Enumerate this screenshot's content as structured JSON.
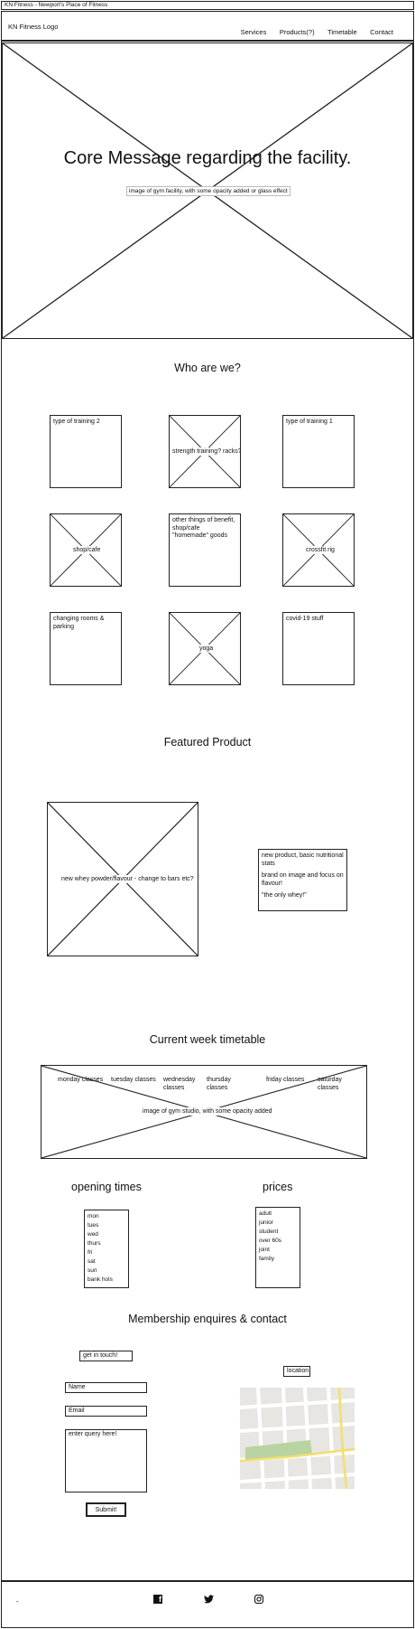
{
  "topbar": {
    "title": "KN Fitness - Newport's Place of Fitness"
  },
  "header": {
    "logo": "KN Fitness Logo",
    "nav": [
      "Services",
      "Products(?)",
      "Timetable",
      "Contact"
    ]
  },
  "hero": {
    "headline": "Core Message regarding the facility.",
    "image_caption": "image of gym facility, with some opacity added or glass effect"
  },
  "who": {
    "heading": "Who are we?",
    "cards": [
      "type of training 2",
      "strength training? racks?",
      "type of training 1",
      "shop/cafe",
      "other things of benefit, shop/cafe \"homemade\" goods",
      "crossfit rig",
      "changing rooms & parking",
      "yoga",
      "covid-19 stuff"
    ]
  },
  "product": {
    "heading": "Featured Product",
    "image_caption": "new whey powder/flavour - change to bars etc?",
    "text_lines": [
      "new product, basic nutritional stats",
      "brand on image and focus on flavour!",
      "\"the only whey!\""
    ]
  },
  "timetable": {
    "heading": "Current week timetable",
    "days": [
      "monday classes",
      "tuesday classes",
      "wednesday classes",
      "thursday classes",
      "friday classes",
      "saturday classes"
    ],
    "image_caption": "image of gym studio, with some opacity added"
  },
  "opening": {
    "heading": "opening times",
    "items": [
      "mon",
      "tues",
      "wed",
      "thurs",
      "fri",
      "sat",
      "sun",
      "bank hols"
    ]
  },
  "prices": {
    "heading": "prices",
    "items": [
      "adult",
      "junior",
      "student",
      "over 60s",
      "joint",
      "family"
    ]
  },
  "contact": {
    "heading": "Membership enquires & contact",
    "get_in_touch": "get in touch!",
    "name_placeholder": "Name",
    "email_placeholder": "Email",
    "query_placeholder": "enter query here!",
    "submit": "Submit!",
    "location": "location"
  },
  "footer": {
    "mark": "-"
  }
}
